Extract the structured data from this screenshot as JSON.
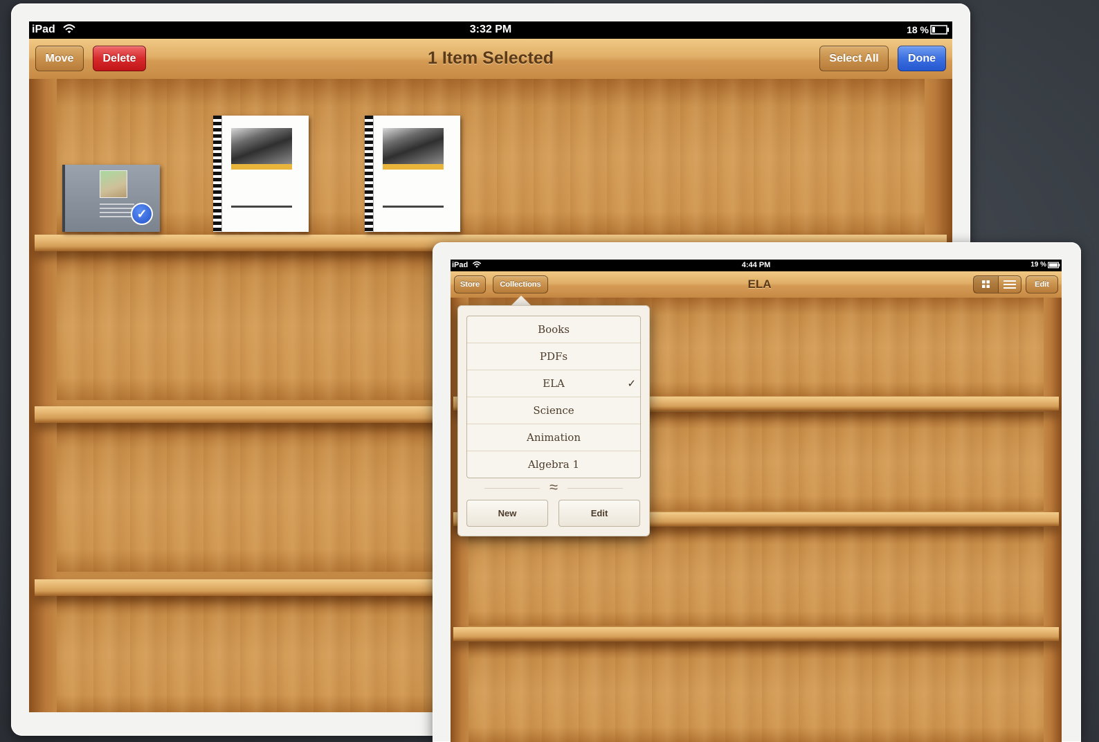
{
  "back_ipad": {
    "status": {
      "device": "iPad",
      "time": "3:32 PM",
      "battery": "18 %"
    },
    "navbar": {
      "move_label": "Move",
      "delete_label": "Delete",
      "title": "1 Item Selected",
      "select_all_label": "Select All",
      "done_label": "Done"
    },
    "books": [
      {
        "kind": "document",
        "selected": true
      },
      {
        "kind": "pdf",
        "selected": false
      },
      {
        "kind": "pdf",
        "selected": false
      }
    ],
    "selected_check": "✓"
  },
  "front_ipad": {
    "status": {
      "device": "iPad",
      "time": "4:44 PM",
      "battery": "19 %"
    },
    "navbar": {
      "store_label": "Store",
      "collections_label": "Collections",
      "title": "ELA",
      "edit_label": "Edit",
      "grid_icon": "grid-view-icon",
      "list_icon": "list-view-icon"
    },
    "collections_popover": {
      "items": [
        "Books",
        "PDFs",
        "ELA",
        "Science",
        "Animation",
        "Algebra 1"
      ],
      "checked_item": "ELA",
      "check_mark": "✓",
      "divider_glyph": "≈",
      "new_label": "New",
      "edit_label": "Edit"
    }
  },
  "colors": {
    "wood": "#d39c57",
    "navbar_wood": "#e0ae67",
    "delete_red": "#d62a2c",
    "done_blue": "#3c6fe0"
  }
}
